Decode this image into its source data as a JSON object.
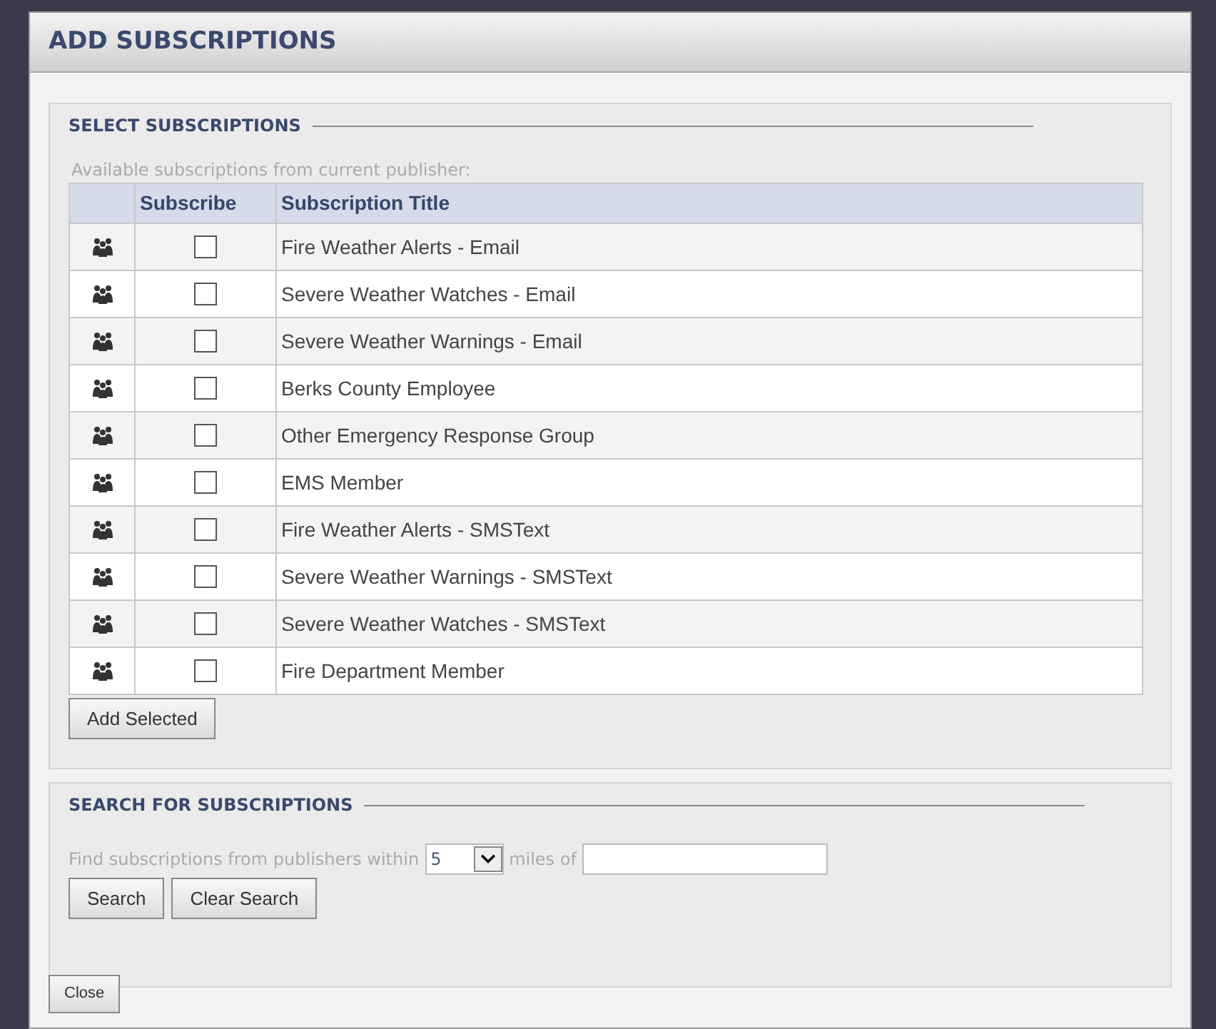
{
  "dialog": {
    "title": "ADD SUBSCRIPTIONS"
  },
  "select_section": {
    "legend": "SELECT SUBSCRIPTIONS",
    "caption": "Available subscriptions from current publisher:",
    "columns": [
      "Subscribe",
      "Subscription Title"
    ],
    "rows": [
      {
        "title": "Fire Weather Alerts - Email",
        "checked": false
      },
      {
        "title": "Severe Weather Watches - Email",
        "checked": false
      },
      {
        "title": "Severe Weather Warnings - Email",
        "checked": false
      },
      {
        "title": "Berks County Employee",
        "checked": false
      },
      {
        "title": "Other Emergency Response Group",
        "checked": false
      },
      {
        "title": "EMS Member",
        "checked": false
      },
      {
        "title": "Fire Weather Alerts - SMSText",
        "checked": false
      },
      {
        "title": "Severe Weather Warnings - SMSText",
        "checked": false
      },
      {
        "title": "Severe Weather Watches - SMSText",
        "checked": false
      },
      {
        "title": "Fire Department Member",
        "checked": false
      }
    ],
    "button": "Add Selected"
  },
  "search_section": {
    "legend": "SEARCH FOR SUBSCRIPTIONS",
    "prefix": "Find subscriptions from publishers within",
    "miles": "5",
    "suffix": "miles of",
    "buttons": [
      "Search",
      "Clear Search"
    ]
  },
  "close_button": "Close"
}
